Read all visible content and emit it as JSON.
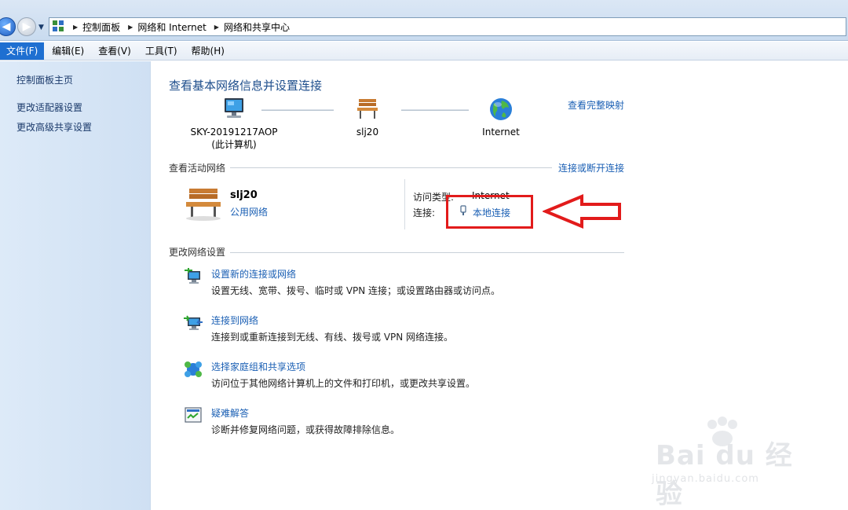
{
  "address_bar": {
    "breadcrumbs": [
      "控制面板",
      "网络和 Internet",
      "网络和共享中心"
    ]
  },
  "menu": {
    "items": [
      "文件(F)",
      "编辑(E)",
      "查看(V)",
      "工具(T)",
      "帮助(H)"
    ],
    "active": "文件(F)"
  },
  "sidebar": {
    "items": [
      "控制面板主页",
      "更改适配器设置",
      "更改高级共享设置"
    ]
  },
  "main": {
    "title": "查看基本网络信息并设置连接",
    "full_map_link": "查看完整映射",
    "map": {
      "computer_name": "SKY-20191217AOP",
      "computer_sub": "(此计算机)",
      "network_name": "slj20",
      "internet_label": "Internet"
    },
    "active_networks": {
      "heading": "查看活动网络",
      "connect_link": "连接或断开连接",
      "network_name": "slj20",
      "network_type": "公用网络",
      "access_type_label": "访问类型:",
      "access_type_value": "Internet",
      "connection_label": "连接:",
      "connection_value": "本地连接"
    },
    "change_settings": {
      "heading": "更改网络设置",
      "tasks": [
        {
          "title": "设置新的连接或网络",
          "desc": "设置无线、宽带、拨号、临时或 VPN 连接；或设置路由器或访问点。",
          "icon": "new-connection-icon"
        },
        {
          "title": "连接到网络",
          "desc": "连接到或重新连接到无线、有线、拨号或 VPN 网络连接。",
          "icon": "connect-network-icon"
        },
        {
          "title": "选择家庭组和共享选项",
          "desc": "访问位于其他网络计算机上的文件和打印机，或更改共享设置。",
          "icon": "homegroup-icon"
        },
        {
          "title": "疑难解答",
          "desc": "诊断并修复网络问题，或获得故障排除信息。",
          "icon": "troubleshoot-icon"
        }
      ]
    }
  },
  "watermark": {
    "text": "Bai du 经验",
    "sub": "jingyan.baidu.com"
  },
  "colors": {
    "link": "#1a5fb4",
    "highlight": "#e21b1b",
    "menu_active": "#1e6fd1"
  }
}
